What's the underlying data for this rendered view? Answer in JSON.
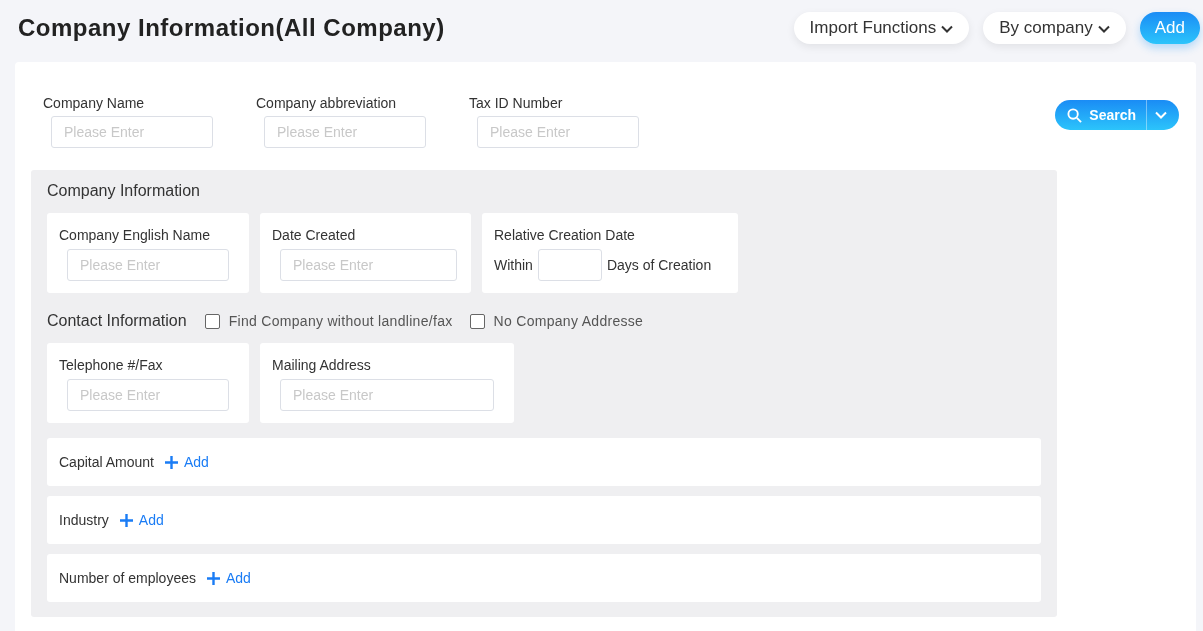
{
  "header": {
    "title": "Company Information(All Company)",
    "buttons": [
      {
        "label": "Import Functions",
        "kind": "dropdown"
      },
      {
        "label": "By company",
        "kind": "dropdown"
      },
      {
        "label": "Add",
        "kind": "primary"
      }
    ]
  },
  "filters": [
    {
      "label": "Company Name",
      "placeholder": "Please Enter"
    },
    {
      "label": "Company abbreviation",
      "placeholder": "Please Enter"
    },
    {
      "label": "Tax ID Number",
      "placeholder": "Please Enter"
    }
  ],
  "search_button": {
    "label": "Search"
  },
  "company_section": {
    "title": "Company Information",
    "fields": [
      {
        "kind": "input",
        "label": "Company English Name",
        "placeholder": "Please Enter"
      },
      {
        "kind": "input",
        "label": "Date Created",
        "placeholder": "Please Enter"
      },
      {
        "kind": "range",
        "label": "Relative Creation Date",
        "prefix": "Within",
        "suffix": "Days of Creation"
      }
    ]
  },
  "contact_section": {
    "title": "Contact Information",
    "options": [
      {
        "label": "Find Company without landline/fax",
        "checked": false
      },
      {
        "label": "No Company Addresse",
        "checked": false
      }
    ],
    "fields": [
      {
        "kind": "input",
        "label": "Telephone #/Fax",
        "placeholder": "Please Enter"
      },
      {
        "kind": "input",
        "label": "Mailing Address",
        "placeholder": "Please Enter"
      }
    ]
  },
  "add_rows": [
    {
      "label": "Capital Amount",
      "action": "Add"
    },
    {
      "label": "Industry",
      "action": "Add"
    },
    {
      "label": "Number of employees",
      "action": "Add"
    }
  ]
}
